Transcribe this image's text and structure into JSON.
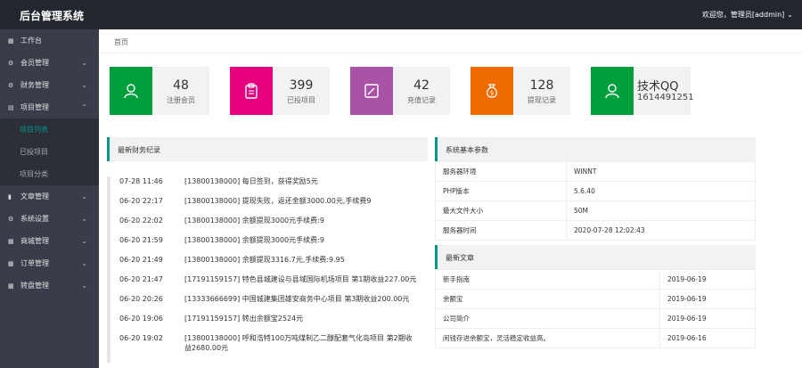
{
  "header": {
    "app_title": "后台管理系统",
    "user_text": "欢迎您，管理员[addmin]",
    "user_caret": "⌄"
  },
  "colors": {
    "topbar": "#23262e",
    "sidebar": "#393d49",
    "accent": "#009688",
    "stat_green": "#009f3c",
    "stat_pink": "#e6007e",
    "stat_purple": "#a853a6",
    "stat_orange": "#f06b00",
    "stat_green2": "#009f3c"
  },
  "sidebar": {
    "items": [
      {
        "label": "工作台",
        "icon": "grid-icon",
        "glyph": "▦"
      },
      {
        "label": "会员管理",
        "icon": "gear-icon",
        "glyph": "⚙",
        "chev": "⌄"
      },
      {
        "label": "财务管理",
        "icon": "gear-icon",
        "glyph": "⚙",
        "chev": "⌄"
      },
      {
        "label": "项目管理",
        "icon": "list-icon",
        "glyph": "▤",
        "chev": "⌃"
      }
    ],
    "sub_items": [
      {
        "label": "项目列表",
        "active": true
      },
      {
        "label": "已投项目"
      },
      {
        "label": "项目分类"
      }
    ],
    "items_after": [
      {
        "label": "文章管理",
        "icon": "document-icon",
        "glyph": "▮",
        "chev": "⌄"
      },
      {
        "label": "系统设置",
        "icon": "gear-icon",
        "glyph": "⚙",
        "chev": "⌄"
      },
      {
        "label": "商城管理",
        "icon": "grid-icon",
        "glyph": "▦",
        "chev": "⌄"
      },
      {
        "label": "订单管理",
        "icon": "grid-icon",
        "glyph": "▦",
        "chev": "⌄"
      },
      {
        "label": "转盘管理",
        "icon": "grid-icon",
        "glyph": "▦",
        "chev": "⌄"
      }
    ]
  },
  "breadcrumb": "首页",
  "stats": [
    {
      "value": "48",
      "label": "注册会员",
      "icon": "user-icon"
    },
    {
      "value": "399",
      "label": "已投项目",
      "icon": "clipboard-icon"
    },
    {
      "value": "42",
      "label": "充值记录",
      "icon": "edit-icon"
    },
    {
      "value": "128",
      "label": "提现记录",
      "icon": "money-bag-icon"
    },
    {
      "value": "技术QQ",
      "label": "1614491251",
      "icon": "user-icon"
    }
  ],
  "finance_panel": {
    "title": "最新财务纪录",
    "rows": [
      {
        "time": "07-28 11:46",
        "msg": "[13800138000] 每日签到，获得奖励5元"
      },
      {
        "time": "06-20 22:17",
        "msg": "[13800138000] 提现失败，返还金额3000.00元,手续费9"
      },
      {
        "time": "06-20 22:02",
        "msg": "[13800138000] 余额提现3000元手续费:9"
      },
      {
        "time": "06-20 21:59",
        "msg": "[13800138000] 余额提现3000元手续费:9"
      },
      {
        "time": "06-20 21:49",
        "msg": "[13800138000] 余额提现3316.7元,手续费:9.95"
      },
      {
        "time": "06-20 21:47",
        "msg": "[17191159157] 特色县城建设与县域国际机场项目 第1期收益227.00元"
      },
      {
        "time": "06-20 20:26",
        "msg": "[13333666699] 中国城建集团雄安商务中心项目 第3期收益200.00元"
      },
      {
        "time": "06-20 19:06",
        "msg": "[17191159157] 转出余额宝2524元"
      },
      {
        "time": "06-20 19:02",
        "msg": "[13800138000] 呼和浩特100万吨煤制乙二醇配套气化岛项目 第2期收益2680.00元"
      }
    ]
  },
  "sys_panel": {
    "title": "系统基本参数",
    "rows": [
      {
        "k": "服务器环境",
        "v": "WINNT"
      },
      {
        "k": "PHP版本",
        "v": "5.6.40"
      },
      {
        "k": "最大文件大小",
        "v": "50M"
      },
      {
        "k": "服务器时间",
        "v": "2020-07-28 12:02:43"
      }
    ]
  },
  "news_panel": {
    "title": "最新文章",
    "rows": [
      {
        "title": "新手指南",
        "date": "2019-06-19"
      },
      {
        "title": "余额宝",
        "date": "2019-06-19"
      },
      {
        "title": "公司简介",
        "date": "2019-06-19"
      },
      {
        "title": "闲钱存进余额宝，灵活稳定收益高。",
        "date": "2019-06-16"
      }
    ]
  }
}
